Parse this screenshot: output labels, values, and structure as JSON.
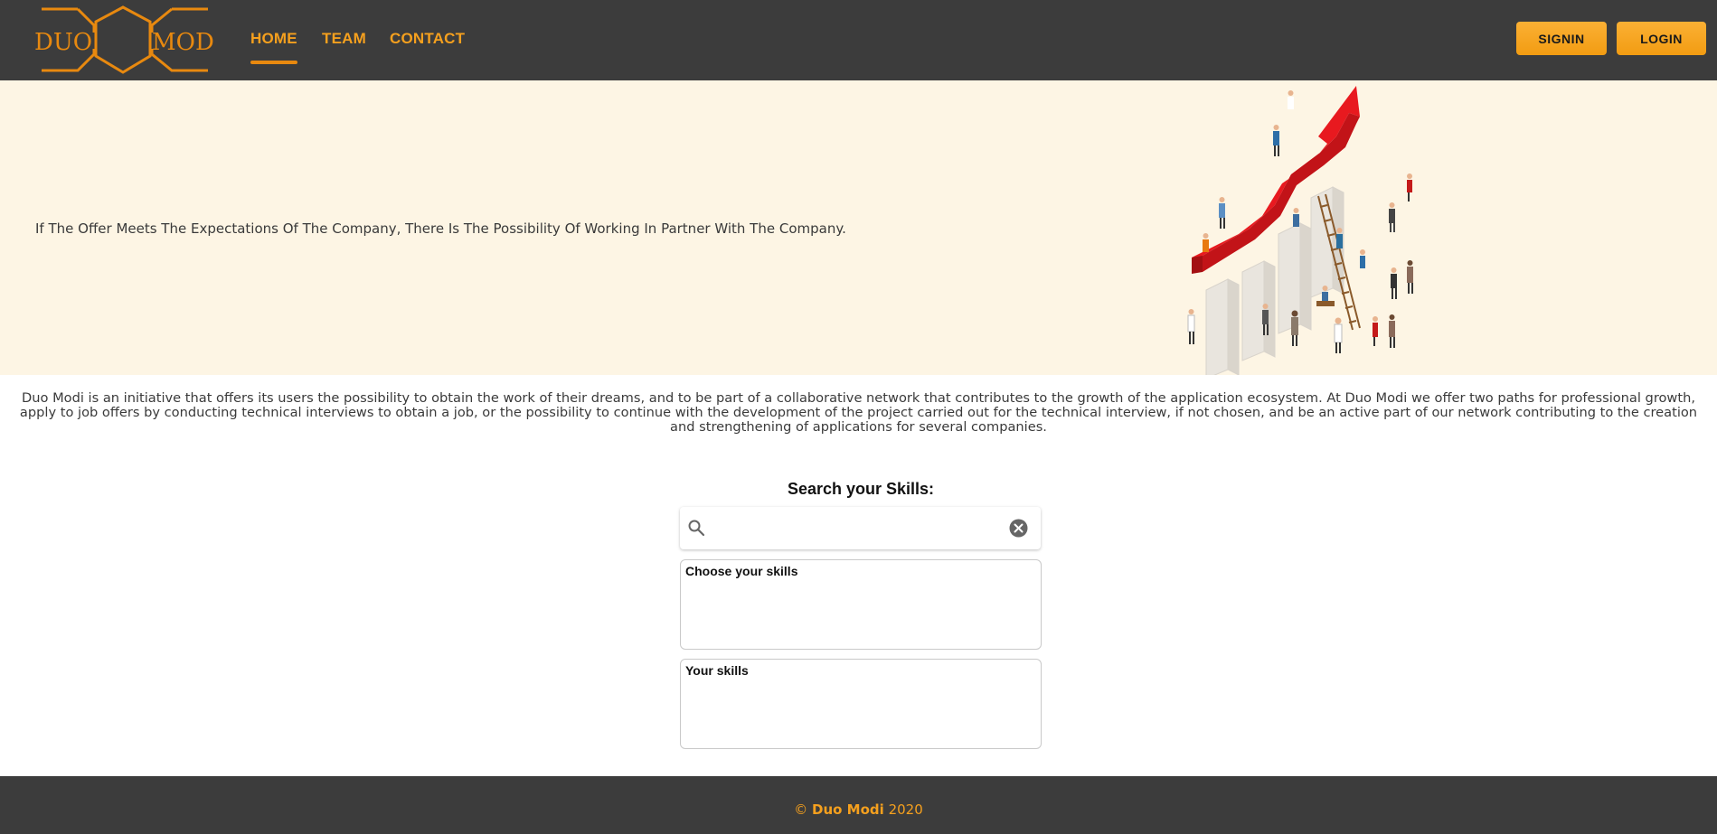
{
  "nav": {
    "logo_left": "DUO",
    "logo_right": "MODI",
    "links": [
      "HOME",
      "TEAM",
      "CONTACT"
    ],
    "signin_label": "SIGNIN",
    "login_label": "LOGIN"
  },
  "hero": {
    "text": "If The Offer Meets The Expectations Of The Company, There Is The Possibility Of Working In Partner With The Company."
  },
  "intro": {
    "text": "Duo Modi is an initiative that offers its users the possibility to obtain the work of their dreams, and to be part of a collaborative network that contributes to the growth of the application ecosystem. At Duo Modi we offer two paths for professional growth, apply to job offers by conducting technical interviews to obtain a job, or the possibility to continue with the development of the project carried out for the technical interview, if not chosen, and be an active part of our network contributing to the creation and strengthening of applications for several companies."
  },
  "search": {
    "title": "Search your Skills:",
    "value": "",
    "choose_label": "Choose your skills",
    "yours_label": "Your skills"
  },
  "footer": {
    "copyright_symbol": "©",
    "brand": "Duo Modi",
    "year": "2020"
  },
  "colors": {
    "accent": "#f5a01e",
    "nav_bg": "#3c3c3c",
    "hero_bg": "#fdf5e4",
    "arrow_red": "#e8191f"
  },
  "icons": [
    "search-icon",
    "clear-icon",
    "hexagon-logo-icon"
  ]
}
